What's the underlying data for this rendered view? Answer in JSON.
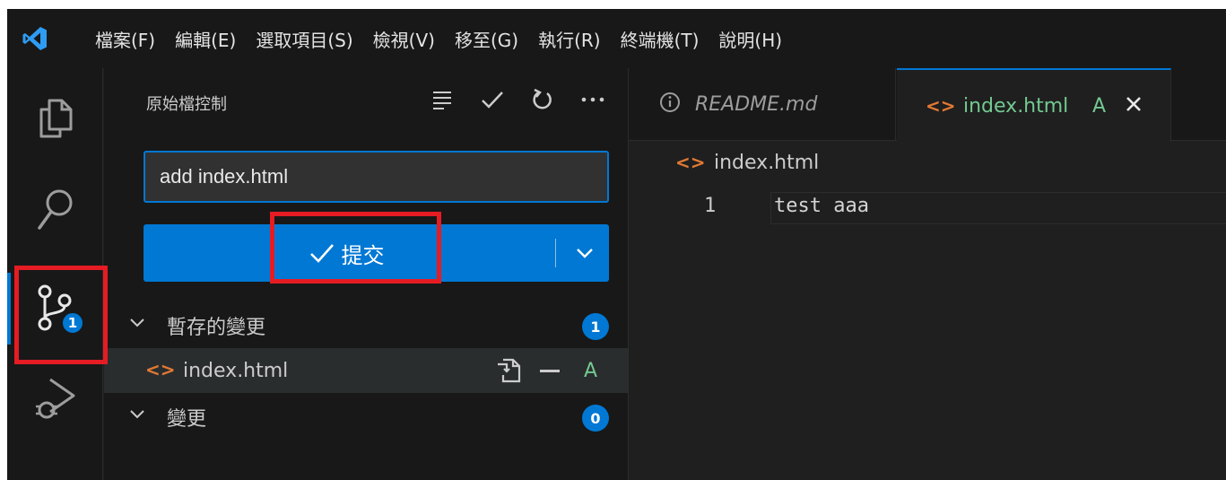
{
  "menu": {
    "items": [
      "檔案(F)",
      "編輯(E)",
      "選取項目(S)",
      "檢視(V)",
      "移至(G)",
      "執行(R)",
      "終端機(T)",
      "說明(H)"
    ]
  },
  "activity_bar": {
    "source_control_badge": "1"
  },
  "sidebar": {
    "title": "原始檔控制",
    "commit_message_value": "add index.html",
    "commit_button_label": "提交",
    "staged": {
      "label": "暫存的變更",
      "count": "1",
      "files": [
        {
          "name": "index.html",
          "status": "A"
        }
      ]
    },
    "changes": {
      "label": "變更",
      "count": "0"
    }
  },
  "editor": {
    "tabs": [
      {
        "label": "README.md"
      },
      {
        "label": "index.html",
        "status": "A"
      }
    ],
    "breadcrumb": "index.html",
    "lines": [
      {
        "number": "1",
        "text": "test aaa"
      }
    ]
  },
  "colors": {
    "accent": "#0078d4",
    "highlight_box": "#e51c23",
    "added_status": "#73c991",
    "html_icon": "#e37933"
  }
}
